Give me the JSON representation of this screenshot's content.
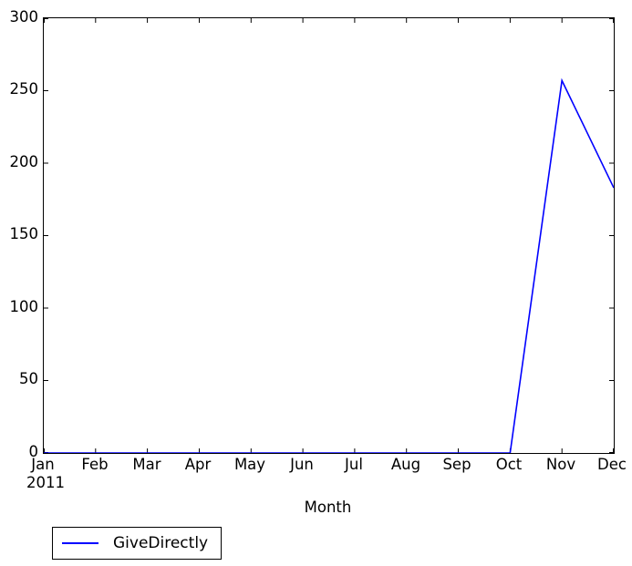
{
  "chart_data": {
    "type": "line",
    "title": "",
    "xlabel": "Month",
    "ylabel": "",
    "categories": [
      "Jan",
      "Feb",
      "Mar",
      "Apr",
      "May",
      "Jun",
      "Jul",
      "Aug",
      "Sep",
      "Oct",
      "Nov",
      "Dec"
    ],
    "x_axis_sublabel": "2011",
    "series": [
      {
        "name": "GiveDirectly",
        "color": "#0000ff",
        "values": [
          0,
          0,
          0,
          0,
          0,
          0,
          0,
          0,
          0,
          0,
          257,
          183
        ]
      }
    ],
    "xlim": [
      0,
      11
    ],
    "ylim": [
      0,
      300
    ],
    "yticks": [
      0,
      50,
      100,
      150,
      200,
      250,
      300
    ],
    "ytick_labels": [
      "0",
      "50",
      "100",
      "150",
      "200",
      "250",
      "300"
    ],
    "grid": false,
    "legend_position": "below-left",
    "legend_entries": [
      "GiveDirectly"
    ]
  },
  "axis": {
    "x_title": "Month"
  }
}
